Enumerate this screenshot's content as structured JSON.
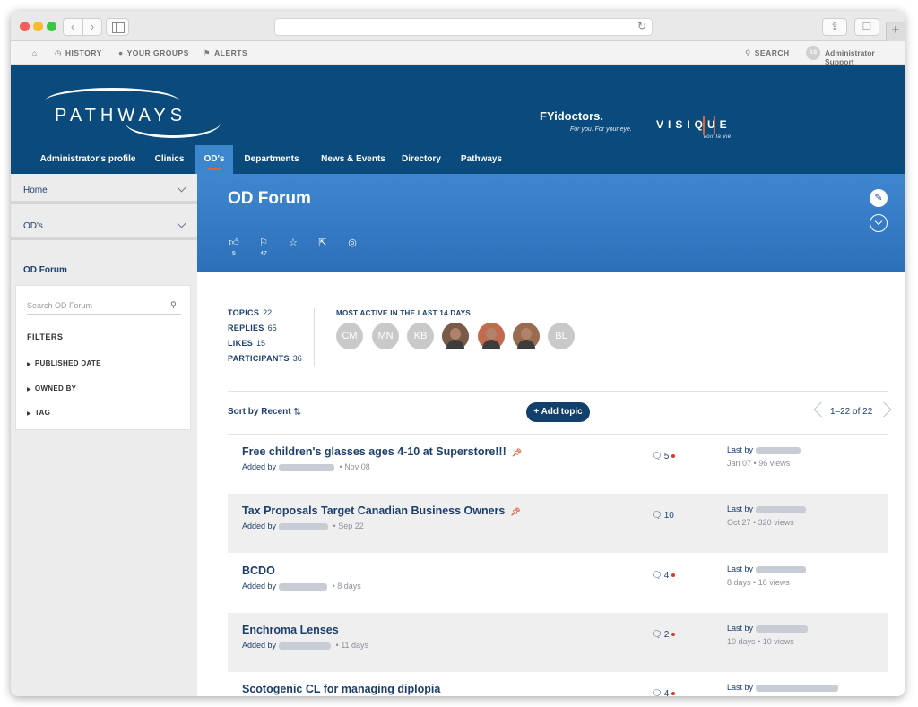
{
  "util_nav": {
    "history": "HISTORY",
    "groups": "YOUR GROUPS",
    "alerts": "ALERTS",
    "search": "SEARCH",
    "user": "Administrator Support",
    "user_initials": "AS"
  },
  "header": {
    "logo": "PATHWAYS",
    "partner1": "FYidoctors.",
    "partner1_tagline": "For you. For your eye.",
    "partner2": "VISIQUE",
    "partner2_tagline": "Voir la vie"
  },
  "main_nav": [
    {
      "label": "Administrator's profile"
    },
    {
      "label": "Clinics"
    },
    {
      "label": "OD's"
    },
    {
      "label": "Departments"
    },
    {
      "label": "News & Events"
    },
    {
      "label": "Directory"
    },
    {
      "label": "Pathways"
    }
  ],
  "sidebar": {
    "links": [
      "Home",
      "OD's"
    ],
    "current": "OD Forum",
    "search_placeholder": "Search OD Forum",
    "filters_title": "FILTERS",
    "filters": [
      "PUBLISHED DATE",
      "OWNED BY",
      "TAG"
    ]
  },
  "forum": {
    "title": "OD Forum",
    "likes_count": "5",
    "flags_count": "47"
  },
  "stats": {
    "topics_label": "TOPICS",
    "topics": "22",
    "replies_label": "REPLIES",
    "replies": "65",
    "likes_label": "LIKES",
    "likes": "15",
    "participants_label": "PARTICIPANTS",
    "participants": "36"
  },
  "most_active": {
    "title": "MOST ACTIVE IN THE LAST 14 DAYS",
    "initials": [
      "CM",
      "MN",
      "KB",
      "",
      "",
      "",
      "BL"
    ]
  },
  "toolbar": {
    "sort_label": "Sort by Recent",
    "add_topic": "Add topic",
    "pagination": "1–22 of 22"
  },
  "topics": [
    {
      "title": "Free children's glasses ages 4-10 at Superstore!!!",
      "pinned": true,
      "added_prefix": "Added by",
      "added_date": "Nov 08",
      "replies": "5",
      "unread": true,
      "last_prefix": "Last by",
      "last_date": "Jan 07",
      "views": "96 views"
    },
    {
      "title": "Tax Proposals Target Canadian Business Owners",
      "pinned": true,
      "added_prefix": "Added by",
      "added_date": "Sep 22",
      "replies": "10",
      "unread": false,
      "last_prefix": "Last by",
      "last_date": "Oct 27",
      "views": "320 views"
    },
    {
      "title": "BCDO",
      "pinned": false,
      "added_prefix": "Added by",
      "added_date": "8 days",
      "replies": "4",
      "unread": true,
      "last_prefix": "Last by",
      "last_date": "8 days",
      "views": "18 views"
    },
    {
      "title": "Enchroma Lenses",
      "pinned": false,
      "added_prefix": "Added by",
      "added_date": "11 days",
      "replies": "2",
      "unread": true,
      "last_prefix": "Last by",
      "last_date": "10 days",
      "views": "10 views"
    },
    {
      "title": "Scotogenic CL for managing diplopia",
      "pinned": false,
      "added_prefix": "",
      "added_date": "",
      "replies": "4",
      "unread": true,
      "last_prefix": "Last by",
      "last_date": "",
      "views": ""
    }
  ],
  "colors": {
    "header_blue": "#0b4a7d",
    "banner_blue": "#3b86cd",
    "accent_orange": "#e0623a",
    "text_navy": "#1c3f6e"
  }
}
